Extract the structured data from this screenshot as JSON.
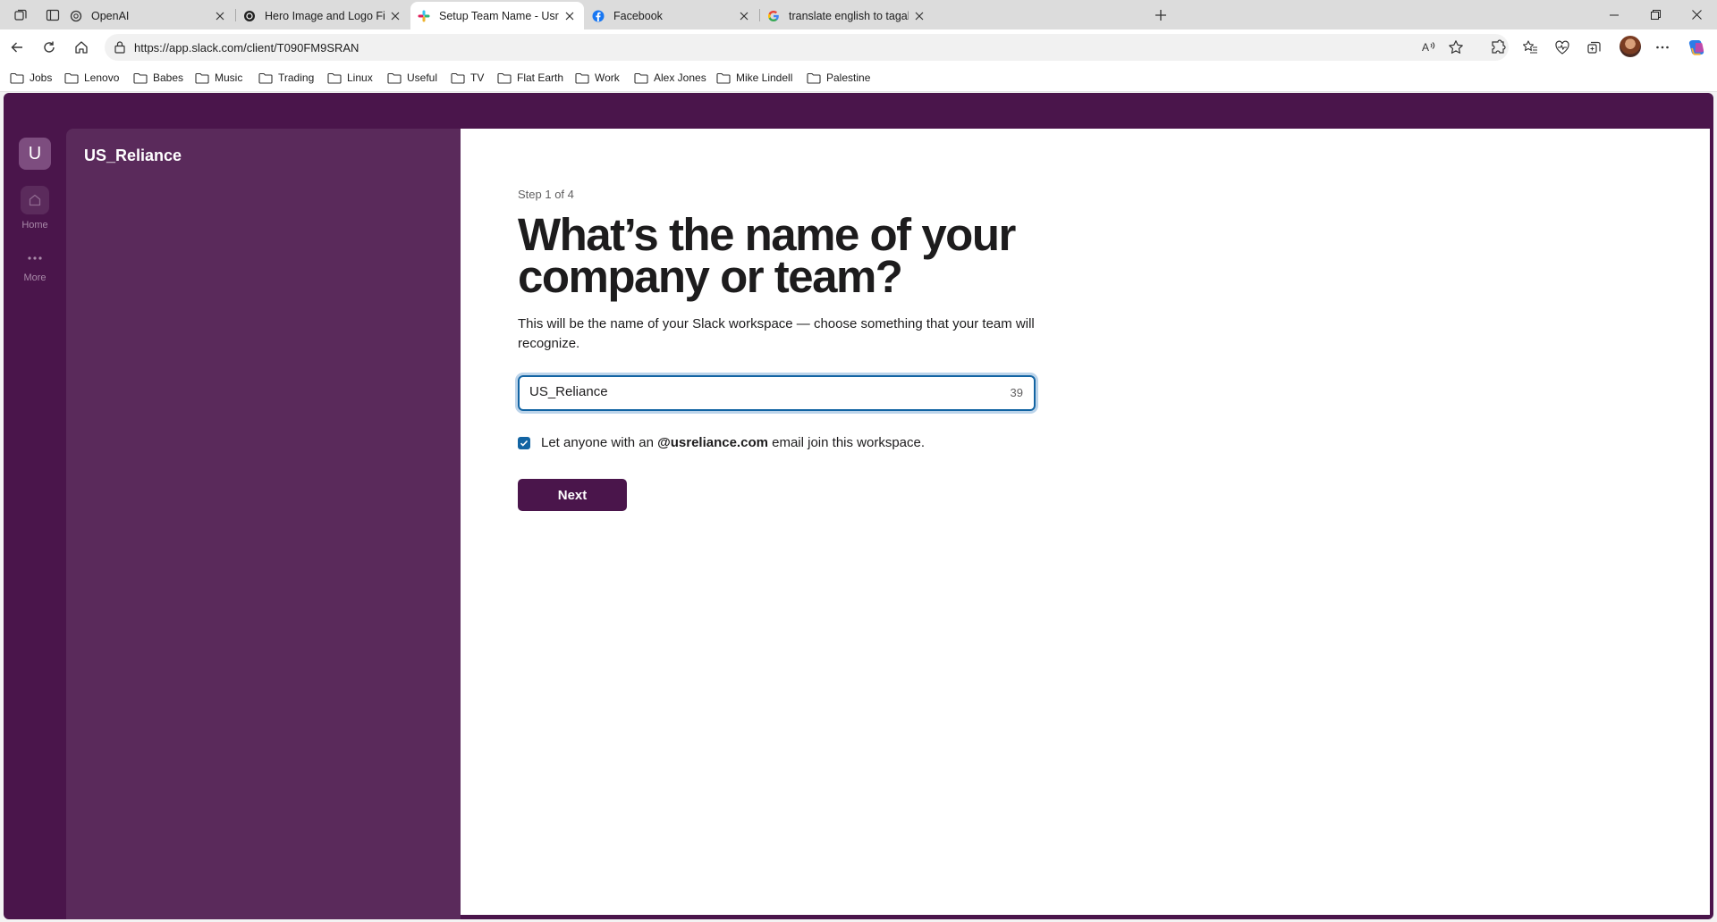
{
  "browser": {
    "tabs": [
      {
        "title": "OpenAI",
        "icon": "openai-icon"
      },
      {
        "title": "Hero Image and Logo Fix",
        "icon": "chatgpt-icon"
      },
      {
        "title": "Setup Team Name - Usreliance - S",
        "icon": "slack-icon",
        "active": true
      },
      {
        "title": "Facebook",
        "icon": "facebook-icon"
      },
      {
        "title": "translate english to tagalog - Goo",
        "icon": "google-icon"
      }
    ],
    "url": "https://app.slack.com/client/T090FM9SRAN",
    "bookmarks": [
      "Jobs",
      "Lenovo",
      "Babes",
      "Music",
      "Trading",
      "Linux",
      "Useful",
      "TV",
      "Flat Earth",
      "Work",
      "Alex Jones",
      "Mike Lindell",
      "Palestine"
    ]
  },
  "slack": {
    "team_initial": "U",
    "rail": {
      "home_label": "Home",
      "more_label": "More"
    },
    "workspace_name": "US_Reliance",
    "setup": {
      "step_text": "Step 1 of 4",
      "heading": "What’s the name of your company or team?",
      "description": "This will be the name of your Slack workspace — choose something that your team will recognize.",
      "name_value": "US_Reliance",
      "remaining_chars": "39",
      "checkbox_checked": true,
      "checkbox_prefix": "Let anyone with an ",
      "checkbox_domain": "@usreliance.com",
      "checkbox_suffix": " email join this workspace.",
      "next_label": "Next"
    },
    "colors": {
      "aubergine": "#4a154b",
      "sidebar": "#5a2a5b",
      "focus_blue": "#1264a3"
    }
  }
}
